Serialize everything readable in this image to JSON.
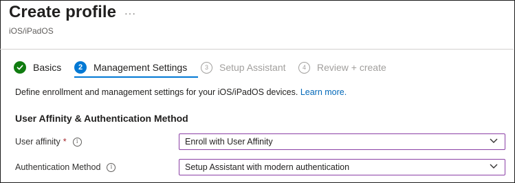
{
  "header": {
    "title": "Create profile",
    "more_icon": "more-ellipsis-icon",
    "more_label": "···",
    "subtitle": "iOS/iPadOS"
  },
  "wizard": {
    "steps": [
      {
        "number": "",
        "label": "Basics",
        "state": "completed",
        "icon": "checkmark-icon"
      },
      {
        "number": "2",
        "label": "Management Settings",
        "state": "current"
      },
      {
        "number": "3",
        "label": "Setup Assistant",
        "state": "upcoming"
      },
      {
        "number": "4",
        "label": "Review + create",
        "state": "upcoming"
      }
    ]
  },
  "description": {
    "text": "Define enrollment and management settings for your iOS/iPadOS devices.",
    "link": "Learn more."
  },
  "section": {
    "heading": "User Affinity & Authentication Method"
  },
  "fields": {
    "user_affinity": {
      "label": "User affinity",
      "required": "*",
      "value": "Enroll with User Affinity"
    },
    "auth_method": {
      "label": "Authentication Method",
      "value": "Setup Assistant with modern authentication"
    }
  },
  "colors": {
    "completed": "#107c10",
    "current": "#0078d4",
    "link": "#0067b8",
    "dropdown_border": "#8a3fa5",
    "required": "#a4262c"
  }
}
